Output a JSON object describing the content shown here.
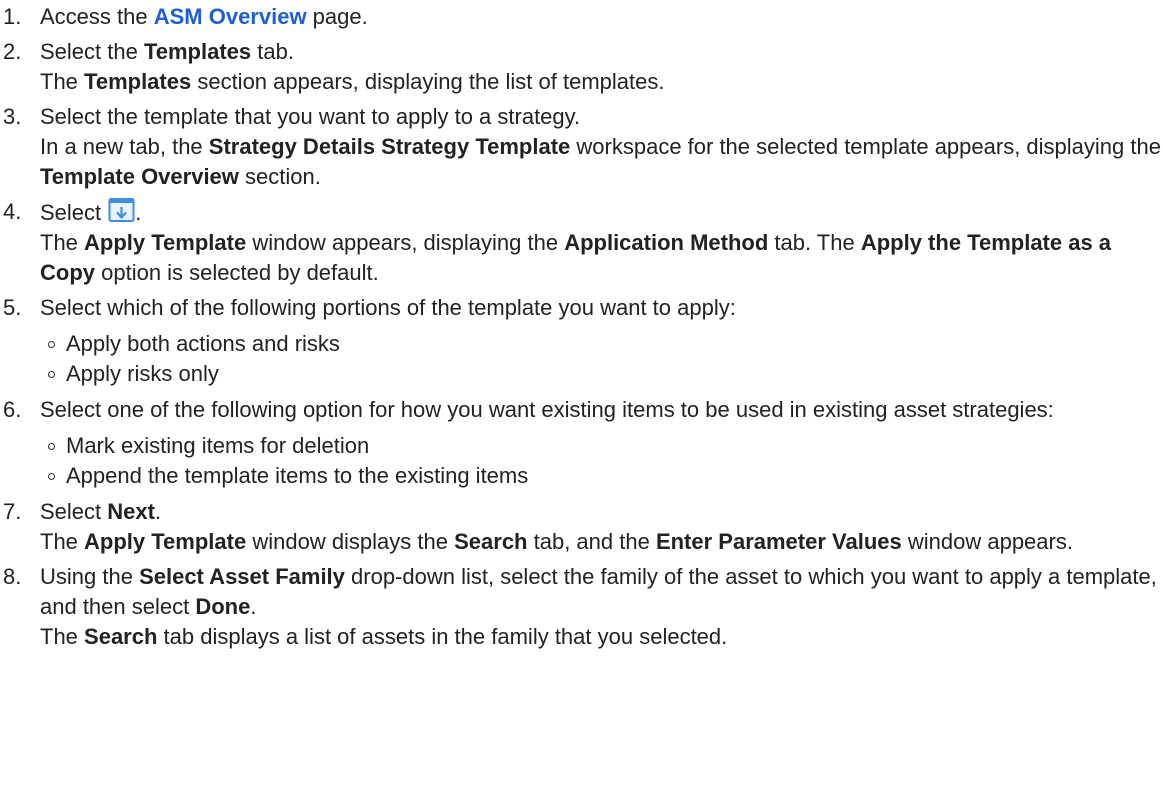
{
  "steps": [
    {
      "num": "1.",
      "pre": "Access the ",
      "link": "ASM Overview",
      "post": " page."
    },
    {
      "num": "2.",
      "a": "Select the ",
      "b": "Templates",
      "c": " tab.",
      "r_pre": "The ",
      "r_b": "Templates",
      "r_post": " section appears, displaying the list of templates."
    },
    {
      "num": "3.",
      "text": "Select the template that you want to apply to a strategy.",
      "r_pre": "In a new tab, the ",
      "r_b1": "Strategy Details Strategy Template",
      "r_mid": " workspace for the selected template appears, displaying the ",
      "r_b2": "Template Overview",
      "r_post": " section."
    },
    {
      "num": "4.",
      "pre": "Select ",
      "icon": "apply-template-icon",
      "post": ".",
      "r1_pre": "The ",
      "r1_b1": "Apply Template",
      "r1_mid": " window appears, displaying the ",
      "r1_b2": "Application Method",
      "r1_post": " tab. The ",
      "r2_b": "Apply the Template as a Copy",
      "r2_post": " option is selected by default."
    },
    {
      "num": "5.",
      "text": "Select which of the following portions of the template you want to apply:",
      "bullets": [
        "Apply both actions and risks",
        "Apply risks only"
      ]
    },
    {
      "num": "6.",
      "text": "Select one of the following option for how you want existing items to be used in existing asset strategies:",
      "bullets": [
        "Mark existing items for deletion",
        "Append the template items to the existing items"
      ]
    },
    {
      "num": "7.",
      "pre": "Select ",
      "b": "Next",
      "post": ".",
      "r_pre": "The ",
      "r_b1": "Apply Template",
      "r_mid1": " window displays the ",
      "r_b2": "Search",
      "r_mid2": " tab, and the ",
      "r_b3": "Enter Parameter Values",
      "r_post": " window appears."
    },
    {
      "num": "8.",
      "pre": "Using the ",
      "b1": "Select Asset Family",
      "mid": " drop-down list, select the family of the asset to which you want to apply a template, and then select ",
      "b2": "Done",
      "post": ".",
      "r_pre": "The ",
      "r_b": "Search",
      "r_post": " tab displays a list of assets in the family that you selected."
    }
  ]
}
